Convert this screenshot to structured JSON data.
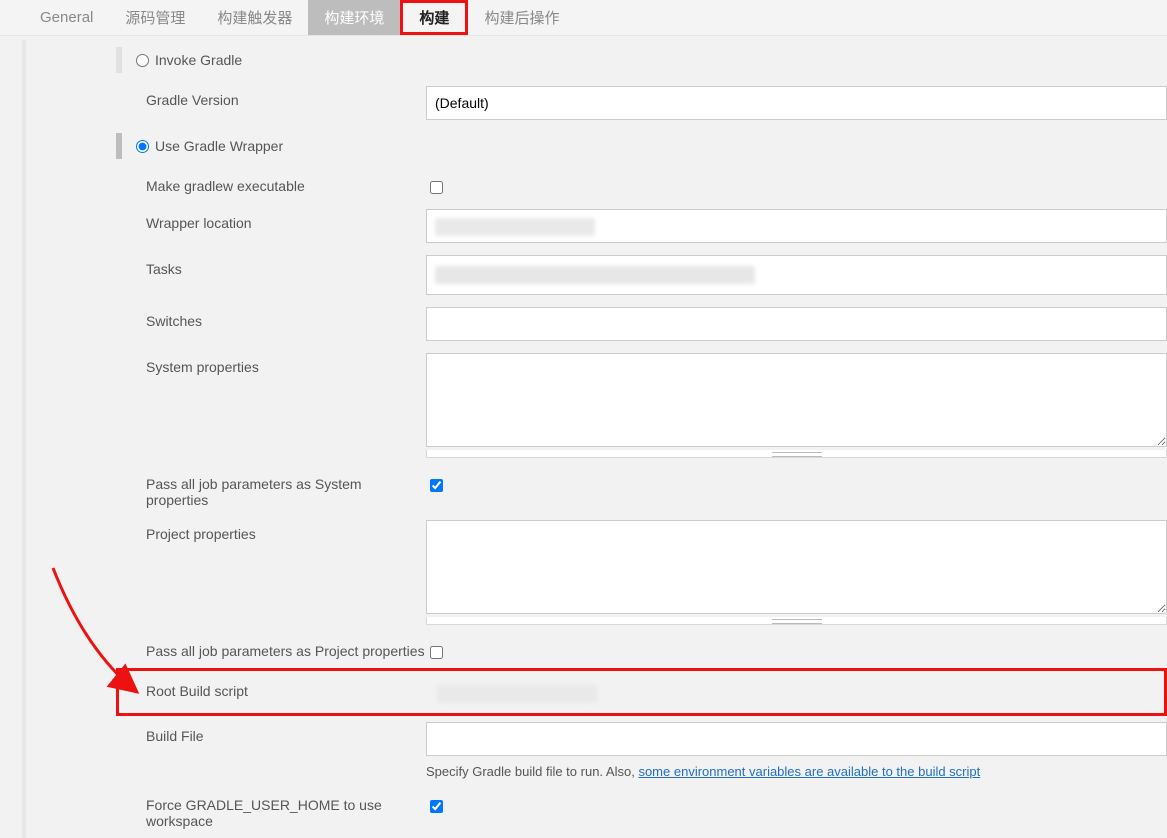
{
  "tabs": {
    "general": "General",
    "scm": "源码管理",
    "triggers": "构建触发器",
    "env": "构建环境",
    "build": "构建",
    "post": "构建后操作"
  },
  "radios": {
    "invoke": "Invoke Gradle",
    "wrapper": "Use Gradle Wrapper"
  },
  "labels": {
    "gradle_version": "Gradle Version",
    "make_exec": "Make gradlew executable",
    "wrapper_loc": "Wrapper location",
    "tasks": "Tasks",
    "switches": "Switches",
    "sys_props": "System properties",
    "pass_sys": "Pass all job parameters as System properties",
    "proj_props": "Project properties",
    "pass_proj": "Pass all job parameters as Project properties",
    "root_script": "Root Build script",
    "build_file": "Build File",
    "force_home": "Force GRADLE_USER_HOME to use workspace"
  },
  "values": {
    "gradle_version": "(Default)",
    "wrapper_loc": "",
    "tasks": "",
    "switches": "",
    "sys_props": "",
    "proj_props": "",
    "root_script": "",
    "build_file": ""
  },
  "checks": {
    "make_exec": false,
    "pass_sys": true,
    "pass_proj": false,
    "force_home": true
  },
  "hint": {
    "prefix": "Specify Gradle build file to run. Also, ",
    "link": "some environment variables are available to the build script"
  }
}
